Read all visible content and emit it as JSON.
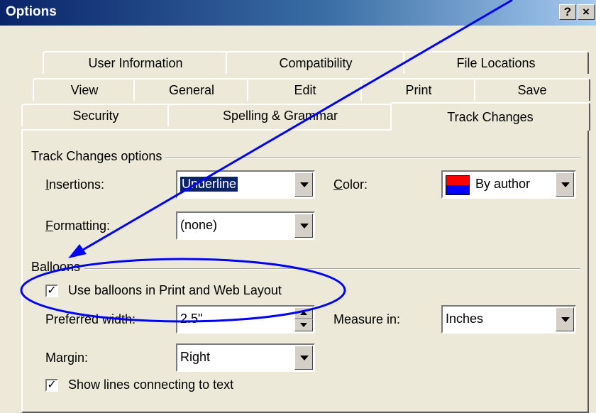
{
  "window": {
    "title": "Options",
    "help_label": "?",
    "close_label": "×"
  },
  "tabs": {
    "row1": [
      "User Information",
      "Compatibility",
      "File Locations"
    ],
    "row2": [
      "View",
      "General",
      "Edit",
      "Print",
      "Save"
    ],
    "row3": [
      "Security",
      "Spelling & Grammar",
      "Track Changes"
    ],
    "active": "Track Changes"
  },
  "track_changes_group": {
    "label": "Track Changes options",
    "insertions_label": "Insertions:",
    "insertions_value": "Underline",
    "color_label": "Color:",
    "color_value": "By author",
    "color_swatch": {
      "top": "#ff0000",
      "bottom": "#0000ff"
    },
    "formatting_label": "Formatting:",
    "formatting_value": "(none)"
  },
  "balloons_group": {
    "label": "Balloons",
    "use_balloons_label": "Use balloons in Print and Web Layout",
    "use_balloons_checked": true,
    "preferred_width_label": "Preferred width:",
    "preferred_width_value": "2.5\"",
    "measure_in_label": "Measure in:",
    "measure_in_value": "Inches",
    "margin_label": "Margin:",
    "margin_value": "Right",
    "show_lines_label": "Show lines connecting to text",
    "show_lines_checked": true
  },
  "annotation": {
    "color": "#0000ff",
    "shapes": [
      "arrow",
      "ellipse"
    ]
  }
}
